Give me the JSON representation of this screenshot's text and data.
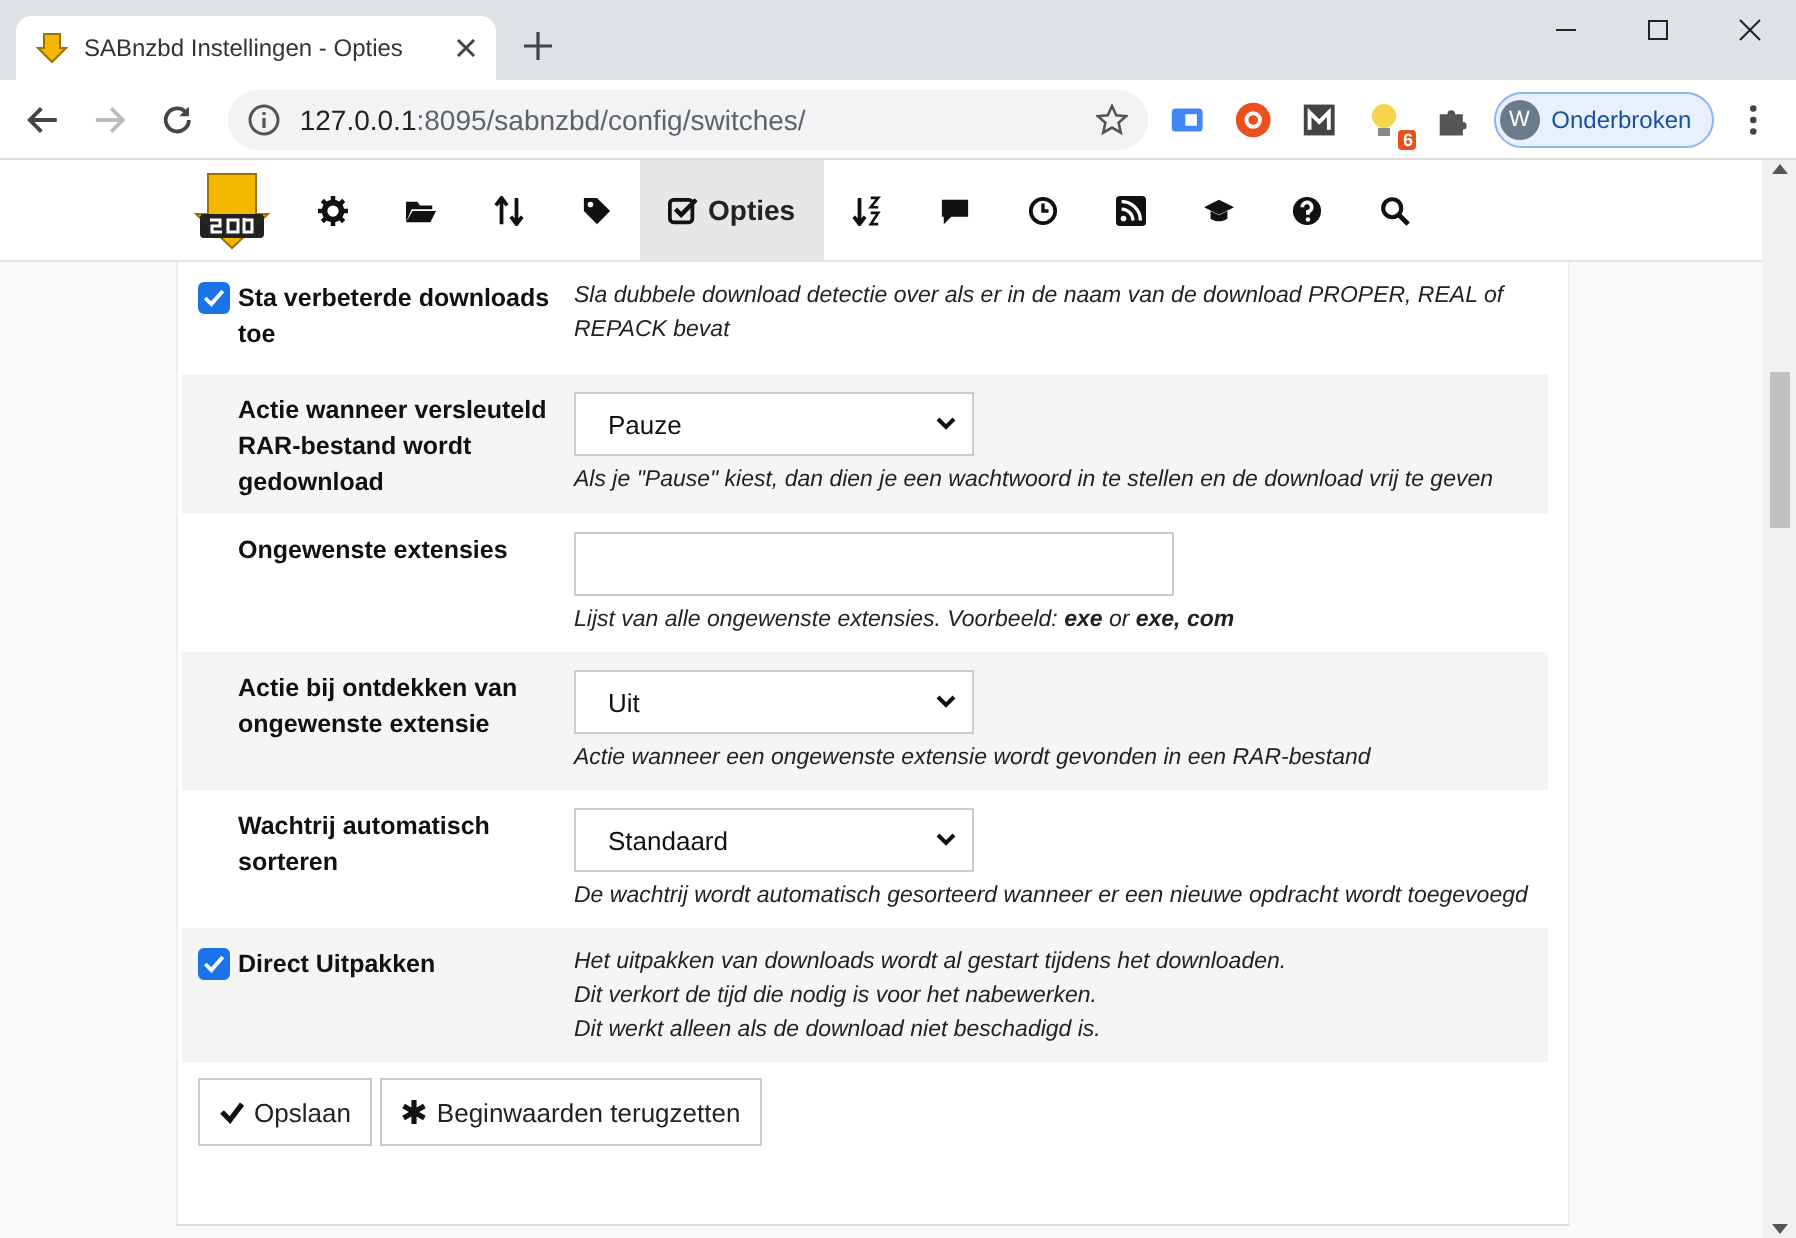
{
  "browser": {
    "tab": {
      "title": "SABnzbd Instellingen - Opties"
    },
    "address": {
      "host": "127.0.0.1",
      "path": ":8095/sabnzbd/config/switches/"
    },
    "extension_badge": "6",
    "profile": {
      "initial": "W",
      "name": "Onderbroken"
    }
  },
  "nav": [
    {
      "selected": false
    },
    {
      "selected": false
    },
    {
      "selected": false
    },
    {
      "selected": false
    },
    {
      "label": "Opties",
      "selected": true
    },
    {
      "selected": false
    },
    {
      "selected": false
    },
    {
      "selected": false
    },
    {
      "selected": false
    },
    {
      "selected": false
    },
    {
      "selected": false
    },
    {
      "selected": false
    }
  ],
  "settings": [
    {
      "kind": "checkbox",
      "label": "Sta verbeterde downloads toe",
      "checked": true,
      "description": [
        "Sla dubbele download detectie over als er in de naam van de download PROPER, REAL of REPACK bevat"
      ]
    },
    {
      "kind": "select",
      "label": "Actie wanneer versleuteld RAR-bestand wordt gedownload",
      "value": "Pauze",
      "description": [
        "Als je \"Pause\" kiest, dan dien je een wachtwoord in te stellen en de download vrij te geven"
      ]
    },
    {
      "kind": "text",
      "label": "Ongewenste extensies",
      "description": [
        "Lijst van alle ongewenste extensies. Voorbeeld: **exe** or **exe, com**"
      ]
    },
    {
      "kind": "select",
      "label": "Actie bij ontdekken van ongewenste extensie",
      "value": "Uit",
      "description": [
        "Actie wanneer een ongewenste extensie wordt gevonden in een RAR-bestand"
      ]
    },
    {
      "kind": "select",
      "label": "Wachtrij automatisch sorteren",
      "value": "Standaard",
      "description": [
        "De wachtrij wordt automatisch gesorteerd wanneer er een nieuwe opdracht wordt toegevoegd"
      ]
    },
    {
      "kind": "checkbox",
      "label": "Direct Uitpakken",
      "checked": true,
      "description": [
        "Het uitpakken van downloads wordt al gestart tijdens het downloaden.",
        "Dit verkort de tijd die nodig is voor het nabewerken.",
        "Dit werkt alleen als de download niet beschadigd is."
      ]
    }
  ],
  "buttons": [
    {
      "label": "Opslaan"
    },
    {
      "label": "Beginwaarden terugzetten"
    }
  ]
}
